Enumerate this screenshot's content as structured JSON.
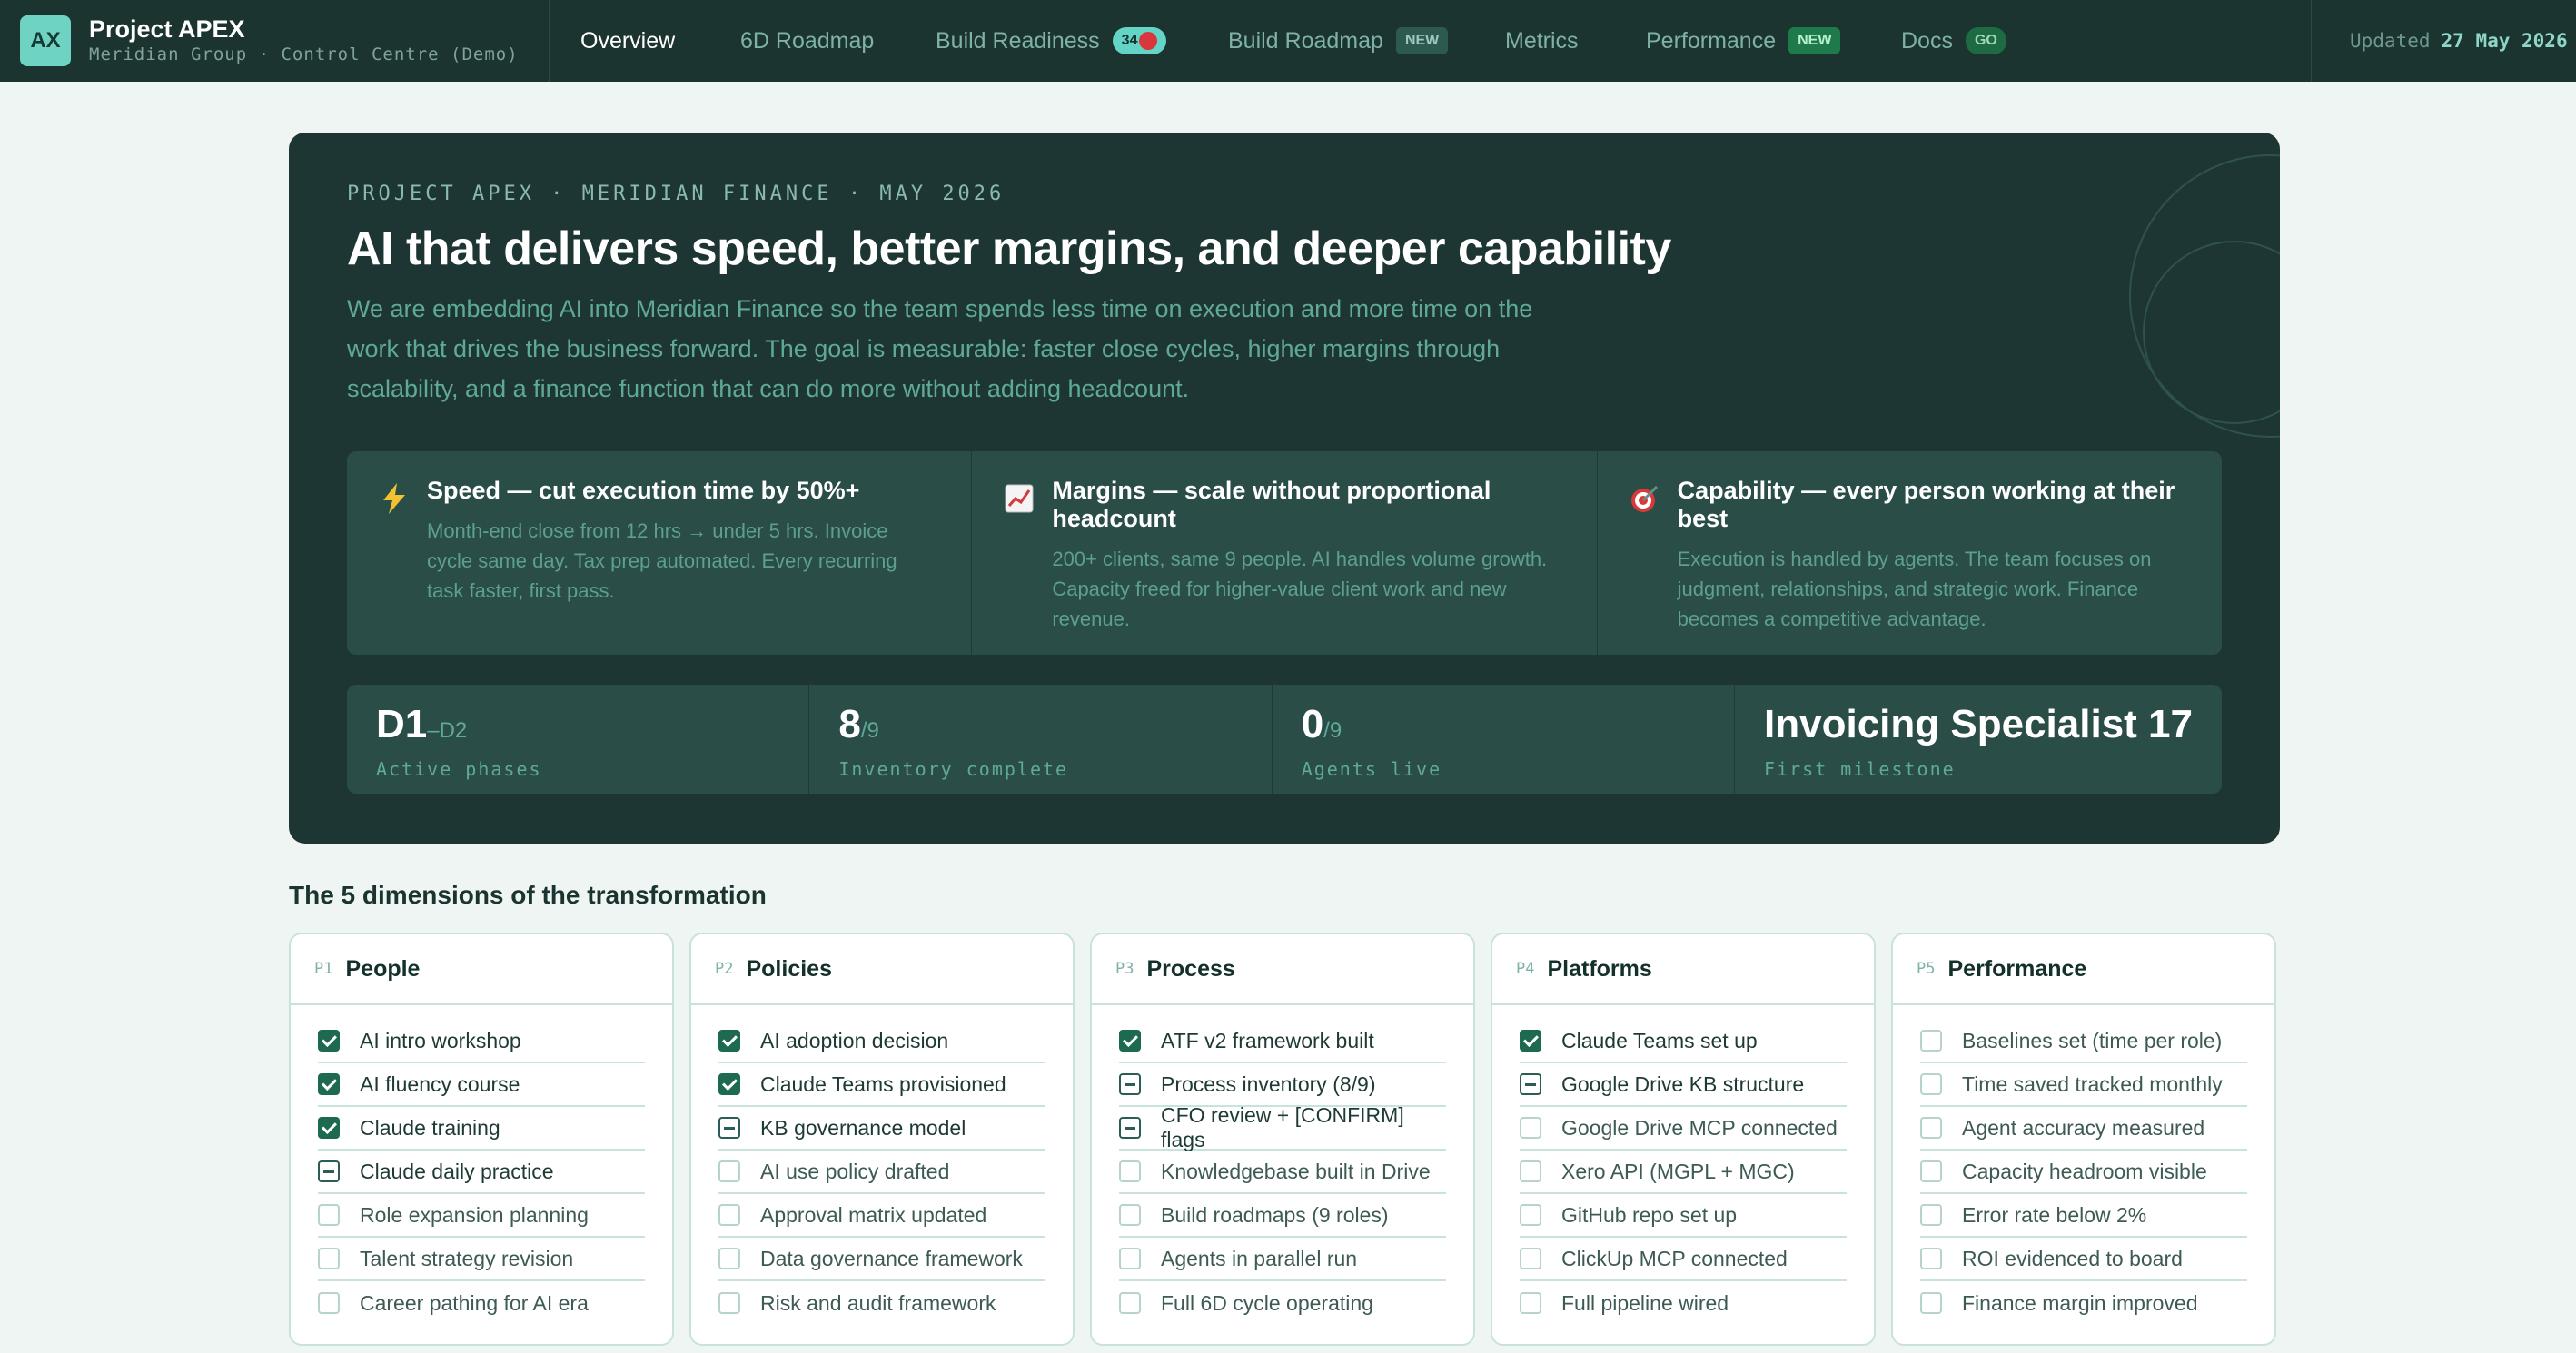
{
  "brand": {
    "logo": "AX",
    "name": "Project APEX",
    "subtitle": "Meridian Group · Control Centre (Demo)"
  },
  "nav": {
    "overview": "Overview",
    "roadmap6d": "6D Roadmap",
    "build_readiness": "Build Readiness",
    "build_readiness_count": "34",
    "build_roadmap": "Build Roadmap",
    "build_roadmap_badge": "NEW",
    "metrics": "Metrics",
    "performance": "Performance",
    "performance_badge": "NEW",
    "docs": "Docs",
    "docs_badge": "GO"
  },
  "updated": {
    "label": "Updated",
    "date": "27 May 2026"
  },
  "hero": {
    "eyebrow": "PROJECT APEX · MERIDIAN FINANCE · MAY 2026",
    "title": "AI that delivers speed, better margins, and deeper capability",
    "description": "We are embedding AI into Meridian Finance so the team spends less time on execution and more time on the work that drives the business forward. The goal is measurable: faster close cycles, higher margins through scalability, and a finance function that can do more without adding headcount.",
    "pillars": [
      {
        "icon": "lightning-icon",
        "title": "Speed — cut execution time by 50%+",
        "desc": "Month-end close from 12 hrs → under 5 hrs. Invoice cycle same day. Tax prep automated. Every recurring task faster, first pass."
      },
      {
        "icon": "chart-icon",
        "title": "Margins — scale without proportional headcount",
        "desc": "200+ clients, same 9 people. AI handles volume growth. Capacity freed for higher-value client work and new revenue."
      },
      {
        "icon": "target-icon",
        "title": "Capability — every person working at their best",
        "desc": "Execution is handled by agents. The team focuses on judgment, relationships, and strategic work. Finance becomes a competitive advantage."
      }
    ],
    "stats": [
      {
        "main": "D1",
        "sub": "–D2",
        "label": "Active phases"
      },
      {
        "main": "8",
        "sub": "/9",
        "label": "Inventory complete"
      },
      {
        "main": "0",
        "sub": "/9",
        "label": "Agents live"
      },
      {
        "main": "Invoicing Specialist 17",
        "sub": "",
        "label": "First milestone"
      }
    ]
  },
  "colors": {
    "nav_bg": "#1b3430",
    "hero_bg": "#1e3633",
    "accent": "#63d4c6",
    "done": "#1e6a50",
    "page_bg": "#eef5f2"
  },
  "dimensions": {
    "title": "The 5 dimensions of the transformation",
    "cards": [
      {
        "code": "P1",
        "name": "People",
        "tasks": [
          {
            "label": "AI intro workshop",
            "status": "done"
          },
          {
            "label": "AI fluency course",
            "status": "done"
          },
          {
            "label": "Claude training",
            "status": "done"
          },
          {
            "label": "Claude daily practice",
            "status": "partial"
          },
          {
            "label": "Role expansion planning",
            "status": "todo"
          },
          {
            "label": "Talent strategy revision",
            "status": "todo"
          },
          {
            "label": "Career pathing for AI era",
            "status": "todo"
          }
        ]
      },
      {
        "code": "P2",
        "name": "Policies",
        "tasks": [
          {
            "label": "AI adoption decision",
            "status": "done"
          },
          {
            "label": "Claude Teams provisioned",
            "status": "done"
          },
          {
            "label": "KB governance model",
            "status": "partial"
          },
          {
            "label": "AI use policy drafted",
            "status": "todo"
          },
          {
            "label": "Approval matrix updated",
            "status": "todo"
          },
          {
            "label": "Data governance framework",
            "status": "todo"
          },
          {
            "label": "Risk and audit framework",
            "status": "todo"
          }
        ]
      },
      {
        "code": "P3",
        "name": "Process",
        "tasks": [
          {
            "label": "ATF v2 framework built",
            "status": "done"
          },
          {
            "label": "Process inventory (8/9)",
            "status": "partial"
          },
          {
            "label": "CFO review + [CONFIRM] flags",
            "status": "partial"
          },
          {
            "label": "Knowledgebase built in Drive",
            "status": "todo"
          },
          {
            "label": "Build roadmaps (9 roles)",
            "status": "todo"
          },
          {
            "label": "Agents in parallel run",
            "status": "todo"
          },
          {
            "label": "Full 6D cycle operating",
            "status": "todo"
          }
        ]
      },
      {
        "code": "P4",
        "name": "Platforms",
        "tasks": [
          {
            "label": "Claude Teams set up",
            "status": "done"
          },
          {
            "label": "Google Drive KB structure",
            "status": "partial"
          },
          {
            "label": "Google Drive MCP connected",
            "status": "todo"
          },
          {
            "label": "Xero API (MGPL + MGC)",
            "status": "todo"
          },
          {
            "label": "GitHub repo set up",
            "status": "todo"
          },
          {
            "label": "ClickUp MCP connected",
            "status": "todo"
          },
          {
            "label": "Full pipeline wired",
            "status": "todo"
          }
        ]
      },
      {
        "code": "P5",
        "name": "Performance",
        "tasks": [
          {
            "label": "Baselines set (time per role)",
            "status": "todo"
          },
          {
            "label": "Time saved tracked monthly",
            "status": "todo"
          },
          {
            "label": "Agent accuracy measured",
            "status": "todo"
          },
          {
            "label": "Capacity headroom visible",
            "status": "todo"
          },
          {
            "label": "Error rate below 2%",
            "status": "todo"
          },
          {
            "label": "ROI evidenced to board",
            "status": "todo"
          },
          {
            "label": "Finance margin improved",
            "status": "todo"
          }
        ]
      }
    ]
  }
}
